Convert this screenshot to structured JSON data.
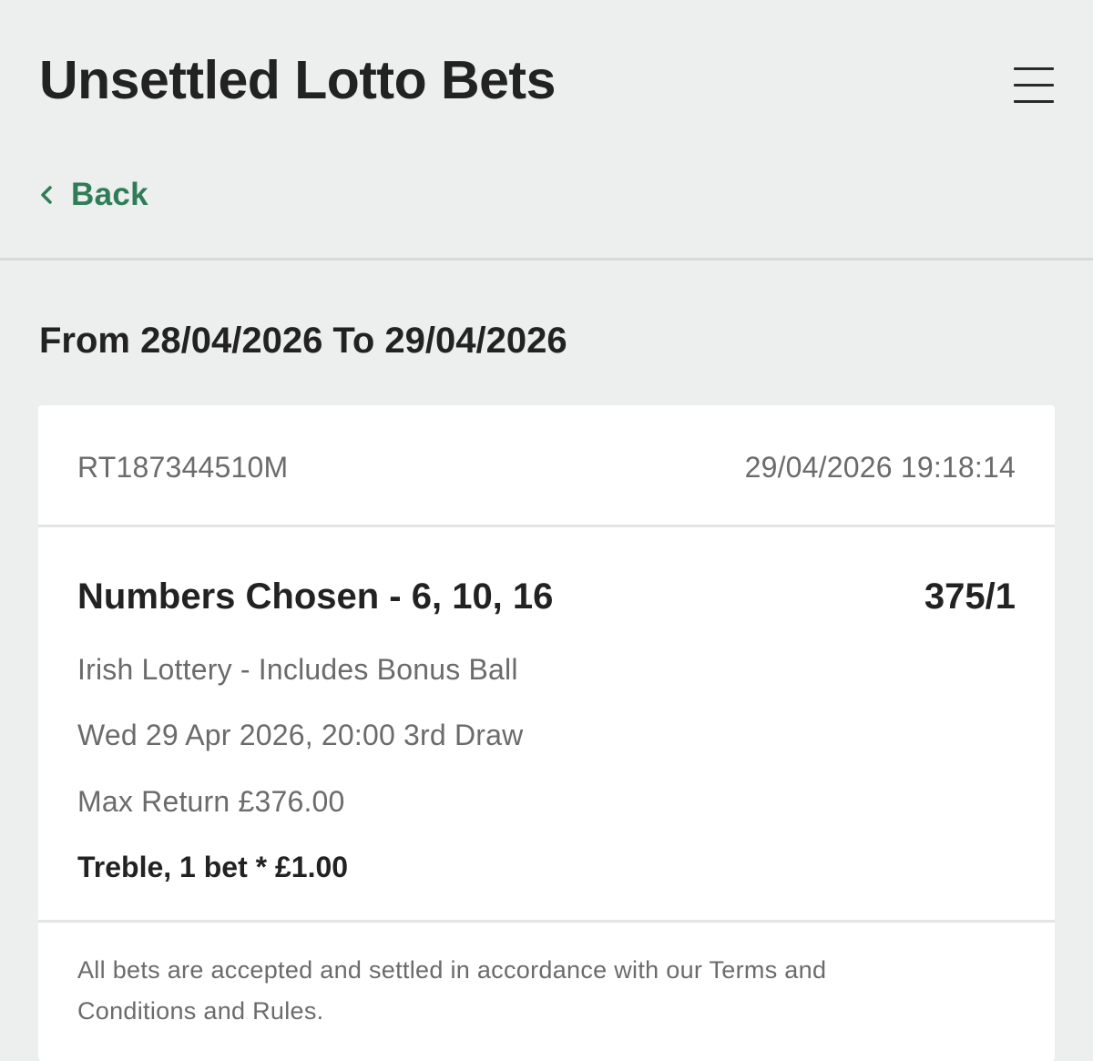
{
  "header": {
    "title": "Unsettled Lotto Bets",
    "back_label": "Back"
  },
  "range": {
    "title": "From 28/04/2026 To 29/04/2026"
  },
  "bet": {
    "reference": "RT187344510M",
    "placed_at": "29/04/2026 19:18:14",
    "selection": "Numbers Chosen - 6, 10, 16",
    "odds": "375/1",
    "market": "Irish Lottery - Includes Bonus Ball",
    "draw": "Wed 29 Apr 2026, 20:00 3rd Draw",
    "max_return": "Max Return £376.00",
    "stake": "Treble, 1 bet * £1.00"
  },
  "footer": {
    "terms": "All bets are accepted and settled in accordance with our Terms and Conditions and Rules."
  },
  "icons": {
    "menu": "hamburger-menu-icon",
    "back": "chevron-left-icon"
  },
  "colors": {
    "background": "#edeeee",
    "card": "#ffffff",
    "accent_green": "#2f7d57",
    "text_primary": "#222222",
    "text_secondary": "#6b6b6b"
  }
}
